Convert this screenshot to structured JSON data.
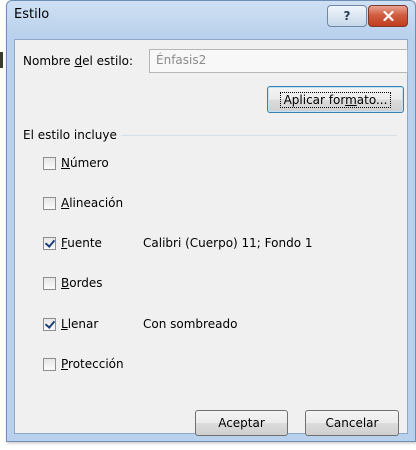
{
  "window": {
    "title": "Estilo",
    "help_glyph": "?",
    "close_glyph": "x"
  },
  "style_name": {
    "label_pre": "Nombre ",
    "label_ul": "d",
    "label_post": "el estilo:",
    "value": "Énfasis2"
  },
  "format_button": {
    "pre": "Aplicar for",
    "ul": "m",
    "post": "ato..."
  },
  "group": {
    "label": "El estilo incluye",
    "items": [
      {
        "ul": "N",
        "rest": "úmero",
        "checked": false,
        "description": ""
      },
      {
        "ul": "A",
        "pre": "",
        "rest": "lineación",
        "checked": false,
        "description": ""
      },
      {
        "ul": "F",
        "rest": "uente",
        "checked": true,
        "description": "Calibri (Cuerpo) 11; Fondo 1"
      },
      {
        "ul": "B",
        "rest": "ordes",
        "checked": false,
        "description": ""
      },
      {
        "ul": "L",
        "rest": "lenar",
        "checked": true,
        "description": "Con sombreado"
      },
      {
        "ul": "P",
        "rest": "rotección",
        "checked": false,
        "description": ""
      }
    ]
  },
  "buttons": {
    "ok": "Aceptar",
    "cancel": "Cancelar"
  }
}
